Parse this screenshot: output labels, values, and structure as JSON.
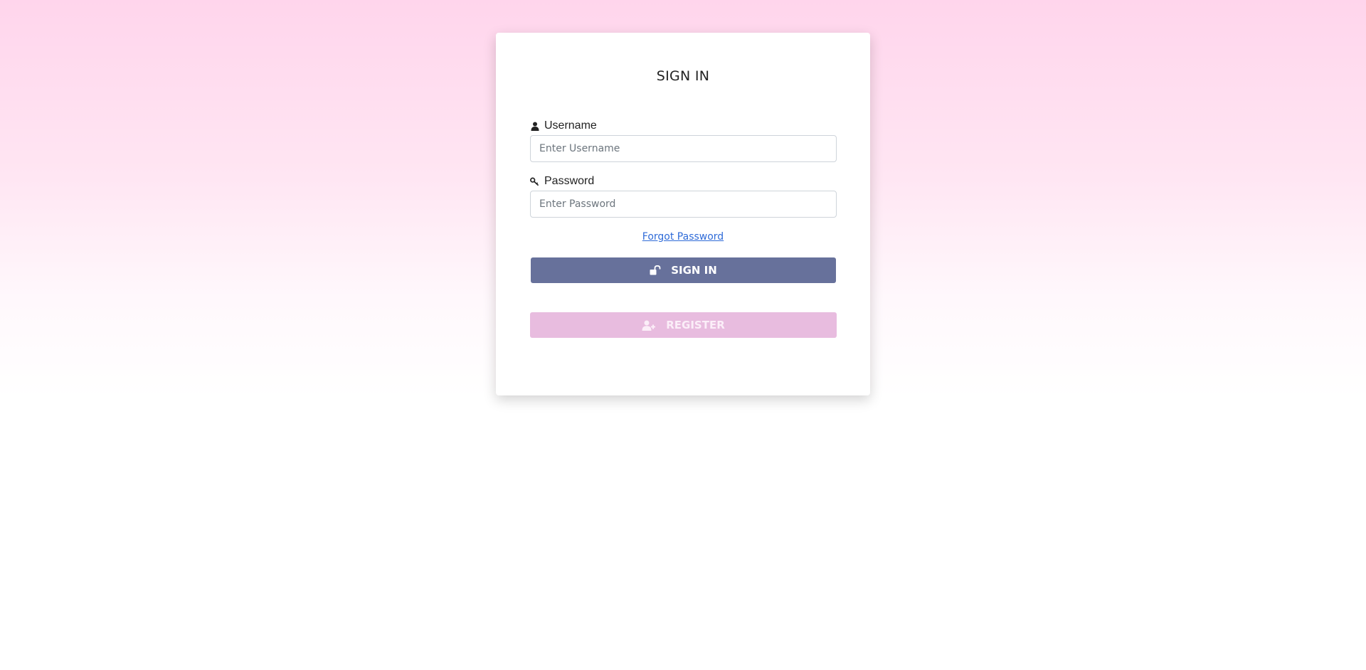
{
  "form": {
    "title": "SIGN IN",
    "username": {
      "label": "Username",
      "placeholder": "Enter Username",
      "value": "",
      "icon": "user-icon"
    },
    "password": {
      "label": "Password",
      "placeholder": "Enter Password",
      "value": "",
      "icon": "key-icon"
    },
    "forgot_link": "Forgot Password",
    "signin_button": {
      "label": "SIGN IN",
      "icon": "unlock-icon",
      "color": "#67719b"
    },
    "register_button": {
      "label": "REGISTER",
      "icon": "user-plus-icon",
      "color": "#e8bcdf"
    }
  },
  "colors": {
    "background_top": "#ffd5ec",
    "background_bottom": "#ffffff",
    "link": "#2f6bd8"
  }
}
